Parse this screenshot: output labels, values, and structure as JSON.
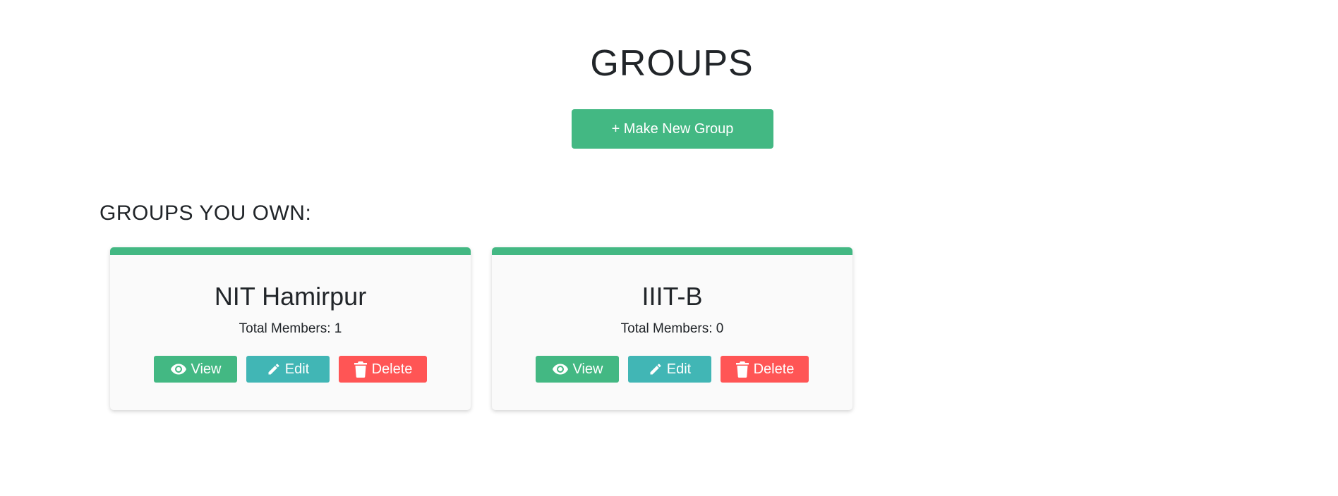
{
  "page": {
    "title": "GROUPS",
    "new_group_label": "+ Make New Group",
    "section_heading": "GROUPS YOU OWN:"
  },
  "colors": {
    "primary_green": "#43b883",
    "teal": "#41b6b5",
    "danger_red": "#ff5555"
  },
  "groups": [
    {
      "name": "NIT Hamirpur",
      "members": "Total Members: 1",
      "view_label": "View",
      "edit_label": "Edit",
      "delete_label": "Delete"
    },
    {
      "name": "IIIT-B",
      "members": "Total Members: 0",
      "view_label": "View",
      "edit_label": "Edit",
      "delete_label": "Delete"
    }
  ],
  "icons": {
    "view": "eye-icon",
    "edit": "pencil-icon",
    "delete": "trash-icon"
  }
}
